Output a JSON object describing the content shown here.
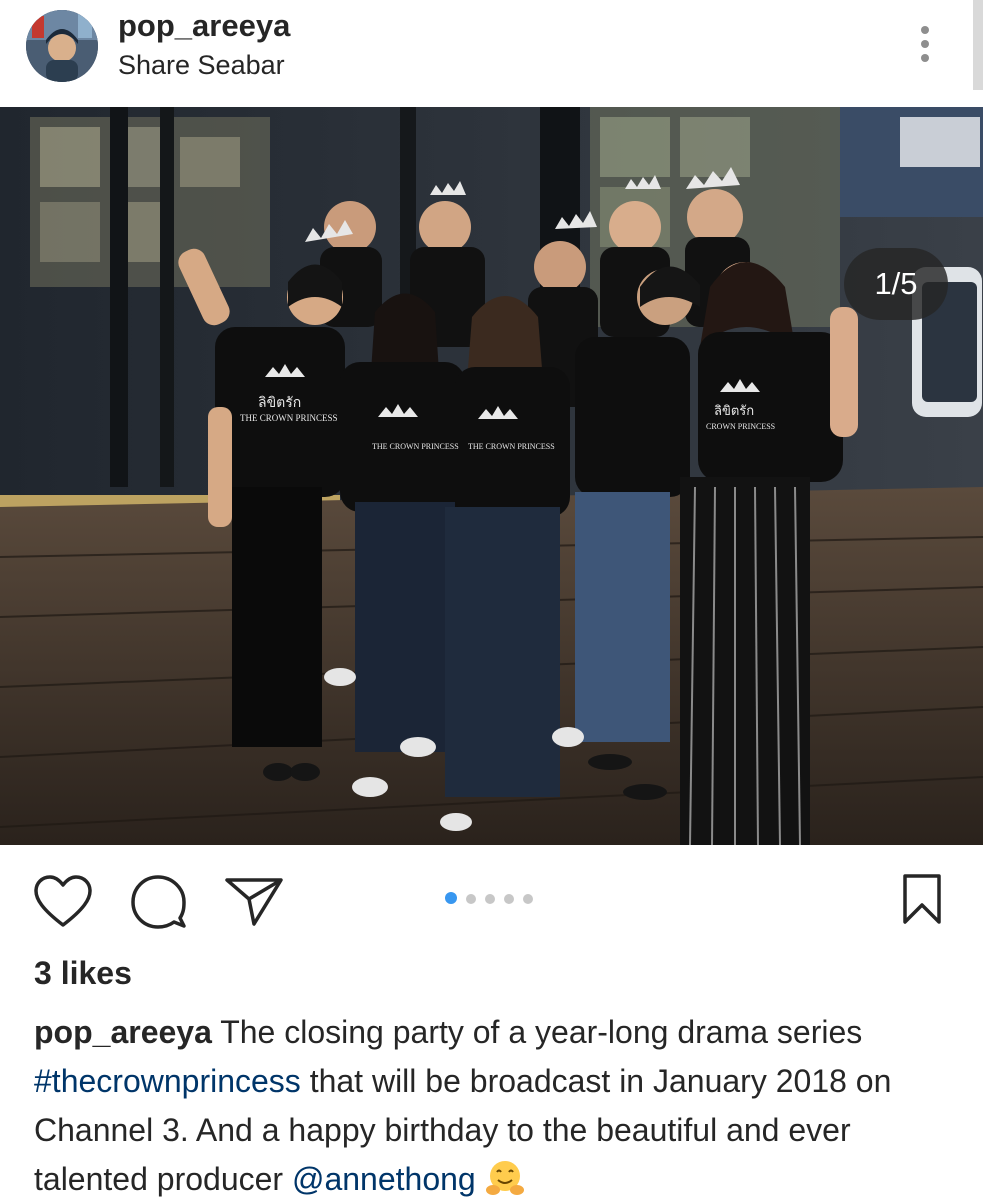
{
  "post": {
    "username": "pop_areeya",
    "location": "Share Seabar",
    "image_counter": "1/5",
    "carousel": {
      "count": 5,
      "active_index": 0
    }
  },
  "photo": {
    "shirt_text_thai": "ลิขิตรัก",
    "shirt_text_en": "THE CROWN PRINCESS"
  },
  "engagement": {
    "likes": "3 likes"
  },
  "caption": {
    "username": "pop_areeya",
    "text_1": "The closing party of a year-long drama series",
    "hashtag": "#thecrownprincess",
    "text_2": "that will be broadcast in January 2018 on Channel 3. And a happy birthday to the beautiful and ever talented producer",
    "mention": "@annethong",
    "emoji": "hugging-face"
  },
  "colors": {
    "link": "#003569",
    "carousel_active": "#3897f0",
    "carousel_inactive": "#c7c7c7",
    "text": "#262626"
  }
}
